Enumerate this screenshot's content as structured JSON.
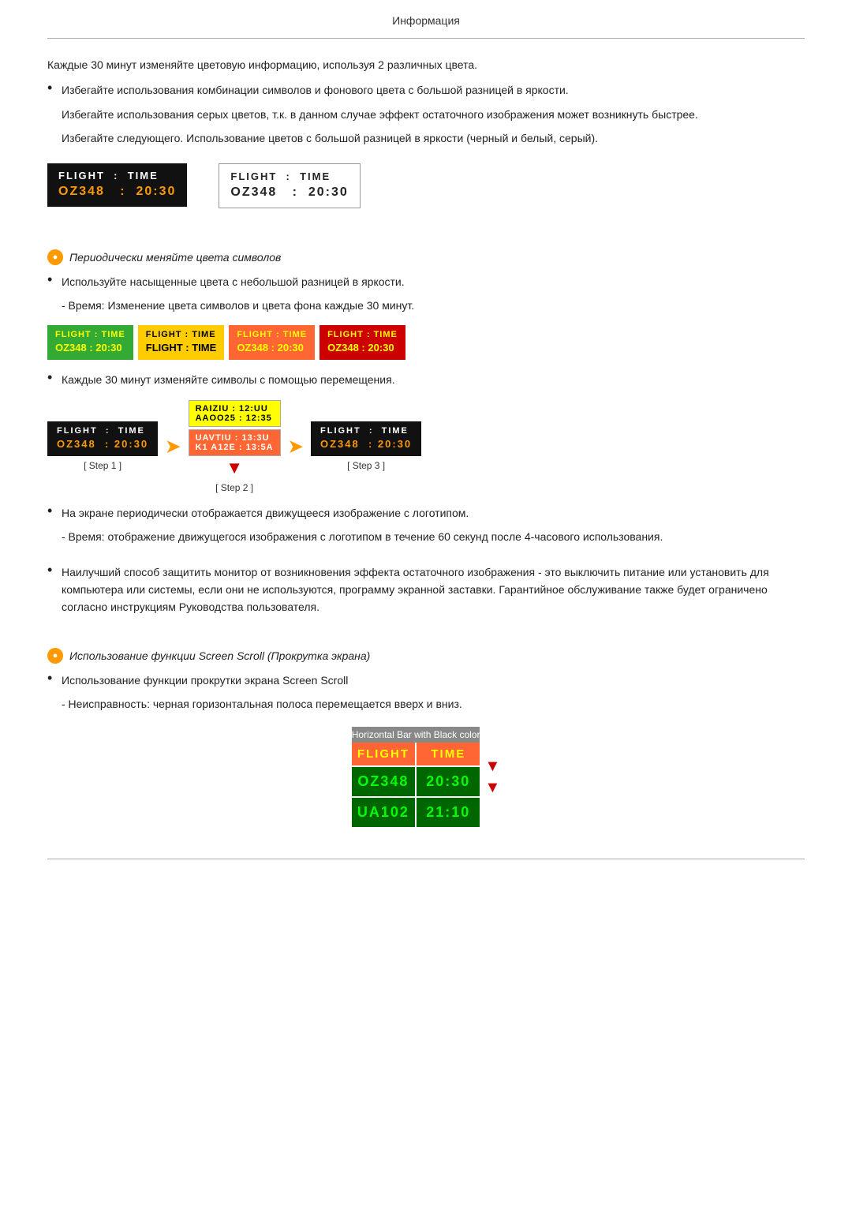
{
  "header": {
    "title": "Информация"
  },
  "paragraphs": {
    "intro": "Каждые 30 минут изменяйте цветовую информацию, используя 2 различных цвета.",
    "bullet1": "Избегайте использования комбинации символов и фонового цвета с большой разницей в яркости.",
    "sub1a": "Избегайте использования серых цветов, т.к. в данном случае эффект остаточного изображения может возникнуть быстрее.",
    "sub1b": "Избегайте следующего. Использование цветов с большой разницей в яркости (черный и белый, серый).",
    "orange_label": "Периодически меняйте цвета символов",
    "bullet2": "Используйте насыщенные цвета с небольшой разницей в яркости.",
    "sub2": "- Время: Изменение цвета символов и цвета фона каждые 30 минут.",
    "bullet3": "Каждые 30 минут изменяйте символы с помощью перемещения.",
    "bullet4": "На экране периодически отображается движущееся изображение с логотипом.",
    "sub4": "- Время: отображение движущегося изображения с логотипом в течение 60 секунд после 4-часового использования.",
    "bullet5": "Наилучший способ защитить монитор от возникновения эффекта остаточного изображения - это выключить питание или установить для компьютера или системы, если они не используются, программу экранной заставки. Гарантийное обслуживание также будет ограничено согласно инструкциям Руководства пользователя.",
    "orange_label2": "Использование функции Screen Scroll (Прокрутка экрана)",
    "bullet6": "Использование функции прокрутки экрана Screen Scroll",
    "sub6": "- Неисправность: черная горизонтальная полоса перемещается вверх и вниз."
  },
  "flight_demo1_dark": {
    "header": "FLIGHT  :  TIME",
    "data": "OZ348   :  20:30"
  },
  "flight_demo1_light": {
    "header": "FLIGHT  :  TIME",
    "data": "OZ348   :  20:30"
  },
  "color_boxes": [
    {
      "header": "FLIGHT : TIME",
      "data": "OZ348  :  20:30",
      "color": "green"
    },
    {
      "header": "FLIGHT : TIME",
      "data": "FLIGHT : TIME",
      "color": "yellow"
    },
    {
      "header": "FLIGHT : TIME",
      "data": "OZ348  :  20:30",
      "color": "orange"
    },
    {
      "header": "FLIGHT : TIME",
      "data": "OZ348  :  20:30",
      "color": "red"
    }
  ],
  "step_diagram": {
    "step1": {
      "header": "FLIGHT  :  TIME",
      "data": "OZ348  :  20:30",
      "label": "[ Step 1 ]"
    },
    "step2_line1": "RAIZIU : 12:UU",
    "step2_line1b": "AAOO25 : 12:35",
    "step2_line2": "UAVTIU : 13:3U",
    "step2_line2b": "K1 A12E : 13:5A",
    "step2_label": "[ Step 2 ]",
    "step3": {
      "header": "FLIGHT  :  TIME",
      "data": "OZ348  :  20:30",
      "label": "[ Step 3 ]"
    }
  },
  "scroll_demo": {
    "title": "Horizontal Bar with Black color",
    "header1": "FLIGHT",
    "header2": "TIME",
    "row1_col1": "OZ348",
    "row1_col2": "20:30",
    "row2_col1": "UA102",
    "row2_col2": "21:10"
  }
}
